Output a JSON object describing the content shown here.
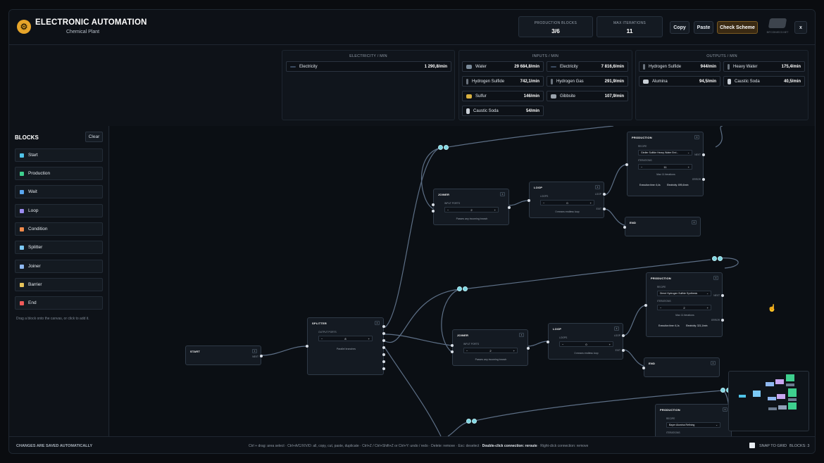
{
  "header": {
    "title": "ELECTRONIC AUTOMATION",
    "subtitle": "Chemical Plant",
    "logo_icon": "gear-icon",
    "production_blocks_label": "PRODUCTION BLOCKS",
    "production_blocks_value": "3/6",
    "max_iterations_label": "MAX ITERATIONS",
    "max_iterations_value": "11",
    "copy_label": "Copy",
    "paste_label": "Paste",
    "check_scheme_label": "Check Scheme",
    "avatar_caption": "BITCOIN/ECO.NET",
    "close_label": "x"
  },
  "electricity_panel": {
    "caption": "ELECTRICITY / MIN",
    "items": [
      {
        "name": "Electricity",
        "value": "1 290,8/min"
      }
    ]
  },
  "inputs_panel": {
    "caption": "INPUTS / MIN",
    "items": [
      {
        "name": "Water",
        "value": "29 684,8/min"
      },
      {
        "name": "Electricity",
        "value": "7 816,6/min"
      },
      {
        "name": "Hydrogen Sulfide",
        "value": "742,1/min"
      },
      {
        "name": "Hydrogen Gas",
        "value": "291,9/min"
      },
      {
        "name": "Sulfur",
        "value": "146/min"
      },
      {
        "name": "Gibbsite",
        "value": "107,9/min"
      },
      {
        "name": "Caustic Soda",
        "value": "54/min"
      }
    ]
  },
  "outputs_panel": {
    "caption": "OUTPUTS / MIN",
    "items": [
      {
        "name": "Hydrogen Sulfide",
        "value": "944/min"
      },
      {
        "name": "Heavy Water",
        "value": "175,4/min"
      },
      {
        "name": "Alumina",
        "value": "94,5/min"
      },
      {
        "name": "Caustic Soda",
        "value": "40,5/min"
      }
    ]
  },
  "sidebar": {
    "title": "BLOCKS",
    "clear_label": "Clear",
    "items": [
      {
        "label": "Start",
        "color": "#4fc3e8"
      },
      {
        "label": "Production",
        "color": "#3ecf8e"
      },
      {
        "label": "Wait",
        "color": "#5aa7f0"
      },
      {
        "label": "Loop",
        "color": "#9b8cf0"
      },
      {
        "label": "Condition",
        "color": "#f08a4b"
      },
      {
        "label": "Splitter",
        "color": "#7cc9f5"
      },
      {
        "label": "Joiner",
        "color": "#8fb8f0"
      },
      {
        "label": "Barrier",
        "color": "#e6c35a"
      },
      {
        "label": "End",
        "color": "#f05a5a"
      }
    ],
    "hint": "Drag a block onto the canvas, or click to add it."
  },
  "nodes": {
    "start": {
      "title": "START",
      "out_label": "NEXT"
    },
    "splitter": {
      "title": "SPLITTER",
      "ports_label": "OUTPUT PORTS",
      "count": "8",
      "note": "Parallel branches"
    },
    "joiner1": {
      "title": "JOINER",
      "ports_label": "INPUT PORTS",
      "count": "2",
      "note": "Passes any incoming branch"
    },
    "loop1": {
      "title": "LOOP",
      "loops_label": "LOOPS",
      "count": "0",
      "note": "0 means endless loop",
      "out_loop": "LOOP",
      "out_exit": "EXIT"
    },
    "prod1": {
      "title": "PRODUCTION",
      "recipe_label": "RECIPE",
      "recipe": "Girdler Sulfide Heavy Water Enri...",
      "iter_label": "ITERATIONS",
      "iterations": "11",
      "max_note": "Max 11 iterations",
      "exec_time": "Execution time: 6,4s",
      "electricity": "Electricity: 699,4/min",
      "out_next": "NEXT",
      "out_error": "ERROR"
    },
    "end1": {
      "title": "END"
    },
    "joiner2": {
      "title": "JOINER",
      "ports_label": "INPUT PORTS",
      "count": "2",
      "note": "Passes any incoming branch"
    },
    "loop2": {
      "title": "LOOP",
      "loops_label": "LOOPS",
      "count": "0",
      "note": "0 means endless loop",
      "out_loop": "LOOP",
      "out_exit": "EXIT"
    },
    "prod2": {
      "title": "PRODUCTION",
      "recipe_label": "RECIPE",
      "recipe": "Direct Hydrogen Sulfide Synthesis",
      "iter_label": "ITERATIONS",
      "iterations": "2",
      "max_note": "Max 11 iterations",
      "exec_time": "Execution time: 6,1s",
      "electricity": "Electricity: 321,1/min",
      "out_next": "NEXT",
      "out_error": "ERROR"
    },
    "end2": {
      "title": "END"
    },
    "prod3": {
      "title": "PRODUCTION",
      "recipe_label": "RECIPE",
      "recipe": "Bayer Alumina Refining",
      "iter_label": "ITERATIONS"
    }
  },
  "footer": {
    "autosave": "CHANGES ARE SAVED AUTOMATICALLY",
    "shortcuts": "Ctrl + drag: area select · Ctrl+A/C/X/V/D: all, copy, cut, paste, duplicate · Ctrl+Z / Ctrl+Shift+Z or Ctrl+Y: undo / redo · Delete: remove · Esc: deselect ·",
    "shortcut_bold": "Double-click connection: reroute",
    "shortcut_tail": "· Right-click connection: remove",
    "snap_label": "SNAP TO GRID",
    "blocks_count": "BLOCKS: 3"
  }
}
